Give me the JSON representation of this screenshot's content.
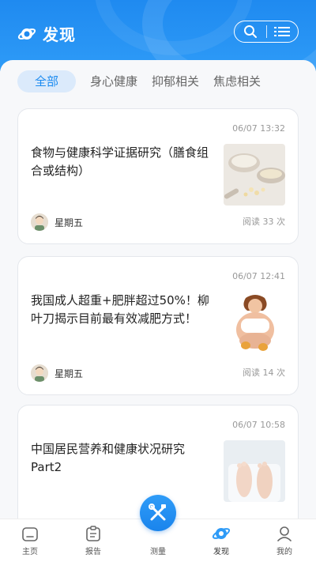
{
  "header": {
    "title": "发现"
  },
  "tabs": [
    {
      "label": "全部",
      "active": true
    },
    {
      "label": "身心健康",
      "active": false
    },
    {
      "label": "抑郁相关",
      "active": false
    },
    {
      "label": "焦虑相关",
      "active": false
    }
  ],
  "articles": [
    {
      "date": "06/07 13:32",
      "title": "食物与健康科学证据研究（膳食组合或结构）",
      "author": "星期五",
      "reads": "阅读 33 次",
      "thumb": "food-bowls-image"
    },
    {
      "date": "06/07 12:41",
      "title": "我国成人超重+肥胖超过50%！柳叶刀揭示目前最有效减肥方式！",
      "author": "星期五",
      "reads": "阅读 14 次",
      "thumb": "overweight-woman-image"
    },
    {
      "date": "06/07 10:58",
      "title": "中国居民营养和健康状况研究Part2",
      "thumb": "feet-on-scale-image"
    }
  ],
  "tabbar": {
    "items": [
      {
        "label": "主页",
        "icon": "home-icon"
      },
      {
        "label": "报告",
        "icon": "report-icon"
      },
      {
        "label": "测量",
        "icon": "measure-tools-icon"
      },
      {
        "label": "发现",
        "icon": "discover-planet-icon",
        "active": true
      },
      {
        "label": "我的",
        "icon": "profile-icon"
      }
    ]
  },
  "colors": {
    "brand": "#1f8af0",
    "active_tab_bg": "#dbeafb",
    "active_tab_text": "#1c8bf0"
  }
}
